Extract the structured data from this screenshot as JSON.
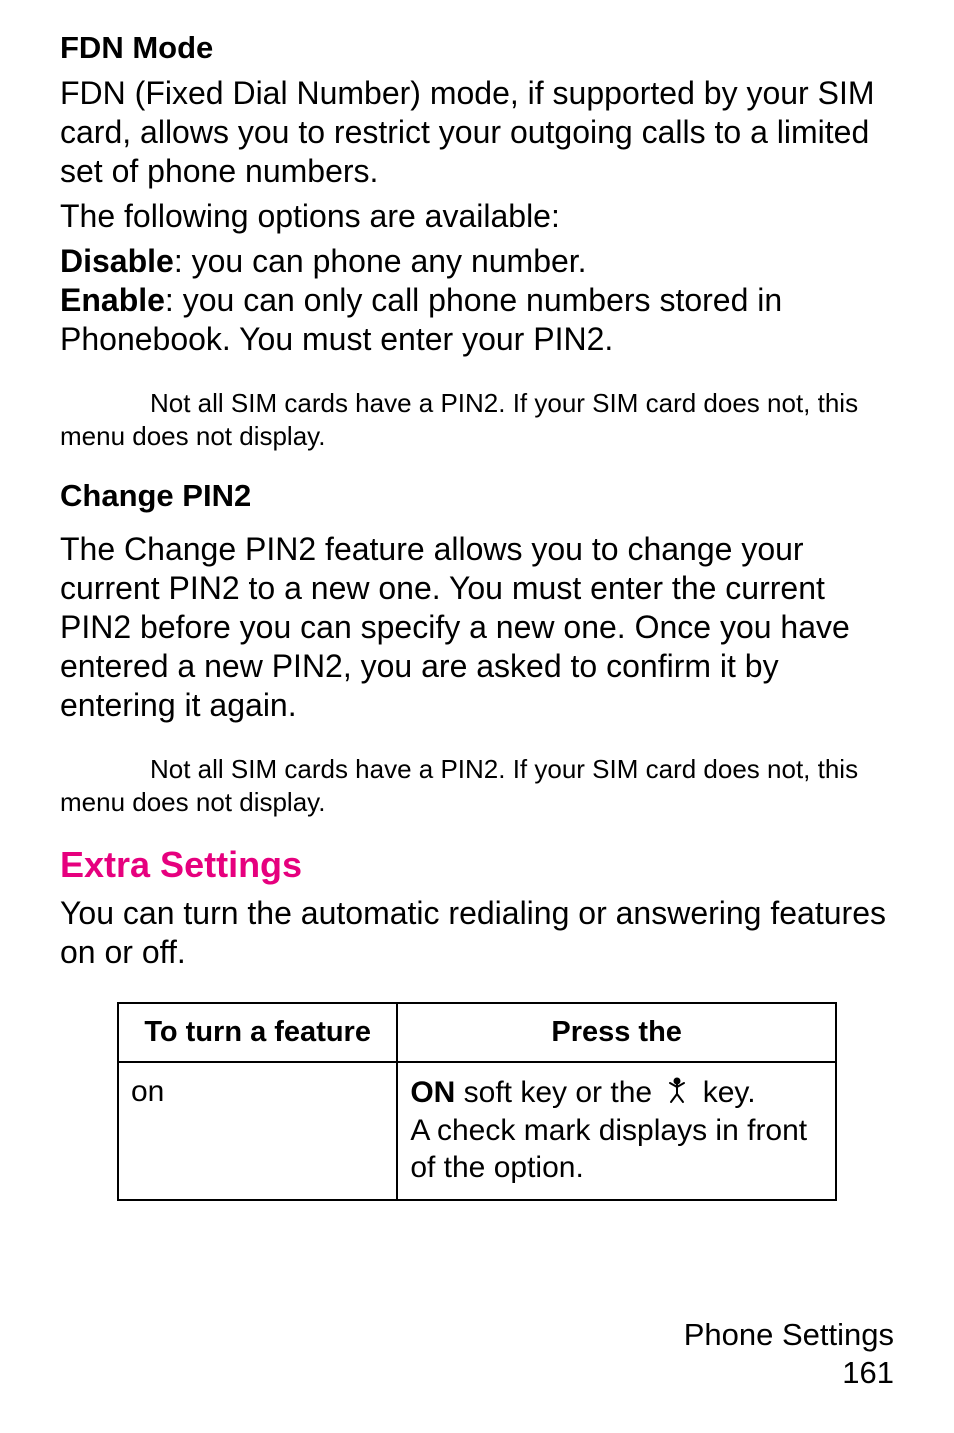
{
  "fdn": {
    "heading": "FDN Mode",
    "p1": "FDN (Fixed Dial Number) mode, if supported by your SIM card, allows you to restrict your outgoing calls to a limited set of phone numbers.",
    "p2": "The following options are available:",
    "disable_label": "Disable",
    "disable_text": ": you can phone any number.",
    "enable_label": "Enable",
    "enable_text": ": you can only call phone numbers stored in Phonebook. You must enter your PIN2.",
    "note_pre": "Not all SIM cards have a PIN2. If your SIM card does not, this menu does not display."
  },
  "changepin2": {
    "heading": "Change PIN2",
    "p1": "The Change PIN2 feature allows you to change your current PIN2 to a new one. You must enter the current PIN2 before you can specify a new one. Once you have entered a new PIN2, you are asked to confirm it by entering it again.",
    "note": "Not all SIM cards have a PIN2. If your SIM card does not, this menu does not display."
  },
  "extra": {
    "heading": "Extra Settings",
    "p1": "You can turn the automatic redialing or answering features on or off."
  },
  "table": {
    "th1": "To turn a feature",
    "th2": "Press the",
    "row1": {
      "col1": "on",
      "on_label": "ON",
      "line1_pre": " soft key or the ",
      "line1_post": " key.",
      "line2": "A check mark displays in front of the option."
    }
  },
  "footer": {
    "section": "Phone Settings",
    "page": "161"
  }
}
